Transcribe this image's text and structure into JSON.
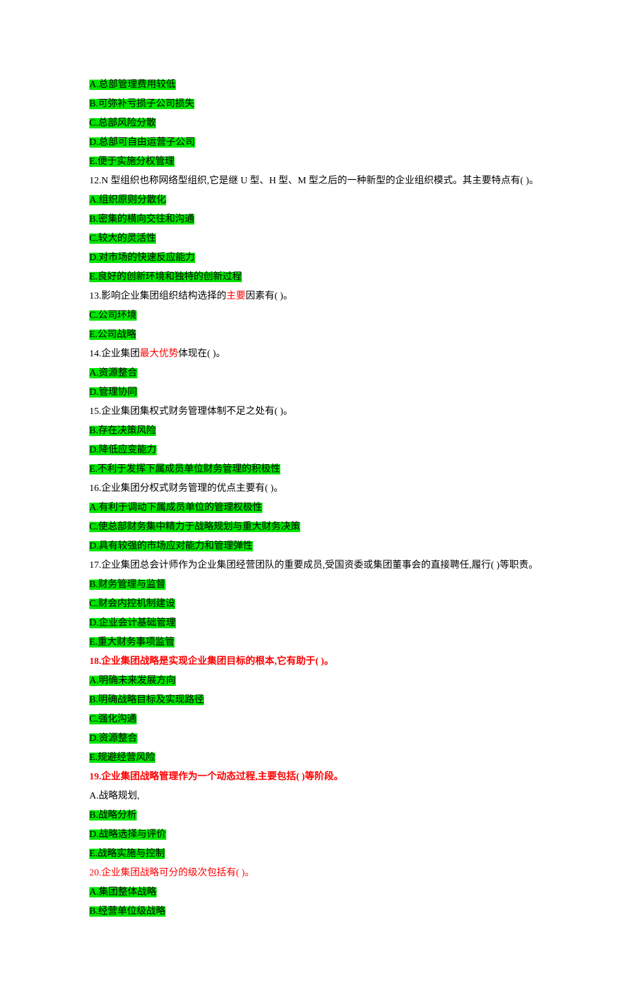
{
  "lines": [
    {
      "text": "A.总部管理费用较低",
      "highlight": true
    },
    {
      "text": "B.可弥补亏损子公司损失",
      "highlight": true
    },
    {
      "text": "C.总部风险分散",
      "highlight": true
    },
    {
      "text": "D.总部可自由运营子公司",
      "highlight": true
    },
    {
      "text": "E.便于实施分权管理",
      "highlight": true
    },
    {
      "text": "12.N 型组织也称网络型组织,它是继 U 型、H 型、M 型之后的一种新型的企业组织模式。其主要特点有( )。"
    },
    {
      "text": "A.组织原则分散化",
      "highlight": true
    },
    {
      "text": "B.密集的横向交往和沟通",
      "highlight": true
    },
    {
      "text": "C.较大的灵活性",
      "highlight": true
    },
    {
      "text": "D.对市场的快速反应能力",
      "highlight": true
    },
    {
      "text": "E.良好的创新环境和独特的创新过程",
      "highlight": true
    },
    {
      "segments": [
        {
          "text": "13.影响企业集团组织结构选择的"
        },
        {
          "text": "主要",
          "red": true
        },
        {
          "text": "因素有( )。"
        }
      ]
    },
    {
      "text": "C.公司环境",
      "highlight": true
    },
    {
      "text": "E.公司战略",
      "highlight": true
    },
    {
      "segments": [
        {
          "text": "14.企业集团"
        },
        {
          "text": "最大优势",
          "red": true
        },
        {
          "text": "体现在( )。"
        }
      ]
    },
    {
      "text": "A.资源整合",
      "highlight": true
    },
    {
      "text": "D.管理协同",
      "highlight": true
    },
    {
      "text": "15.企业集团集权式财务管理体制不足之处有( )。"
    },
    {
      "text": "B.存在决策风险",
      "highlight": true
    },
    {
      "text": "D.降低应变能力",
      "highlight": true
    },
    {
      "text": "E.不利于发挥下属成员单位财务管理的积极性",
      "highlight": true
    },
    {
      "text": "16.企业集团分权式财务管理的优点主要有( )。"
    },
    {
      "text": "A.有利于调动下属成员单位的管理权极性",
      "highlight": true
    },
    {
      "text": "C.使总部财务集中精力于战略规划与重大财务决策",
      "highlight": true
    },
    {
      "text": "D.具有较强的市场应对能力和管理弹性",
      "highlight": true
    },
    {
      "text": "17.企业集团总会计师作为企业集团经营团队的重要成员,受国资委或集团董事会的直接聘任,履行( )等职责。"
    },
    {
      "text": "B.财务管理与监督",
      "highlight": true
    },
    {
      "text": "C.财会内控机制建设",
      "highlight": true
    },
    {
      "text": "D.企业会计基础管理",
      "highlight": true
    },
    {
      "text": "E.重大财务事项监管",
      "highlight": true
    },
    {
      "text": "18.企业集团战略是实现企业集团目标的根本,它有助于( )。",
      "red": true,
      "bold": true
    },
    {
      "text": "A.明确未来发展方向",
      "highlight": true
    },
    {
      "text": "B.明确战略目标及实现路径",
      "highlight": true
    },
    {
      "text": "C.强化沟通",
      "highlight": true
    },
    {
      "text": "D.资源整合",
      "highlight": true
    },
    {
      "text": "E.规避经营风险",
      "highlight": true
    },
    {
      "text": "19.企业集团战略管理作为一个动态过程,主要包括( )等阶段。",
      "red": true,
      "bold": true
    },
    {
      "text": "A.战略规划,"
    },
    {
      "text": "B.战略分析",
      "highlight": true
    },
    {
      "text": "D.战略选择与评价",
      "highlight": true
    },
    {
      "text": "E.战略实施与控制",
      "highlight": true
    },
    {
      "text": "20.企业集团战略可分的级次包括有( )。",
      "red": true
    },
    {
      "text": "A.集团整体战略",
      "highlight": true
    },
    {
      "text": "B.经营单位级战略",
      "highlight": true
    }
  ]
}
